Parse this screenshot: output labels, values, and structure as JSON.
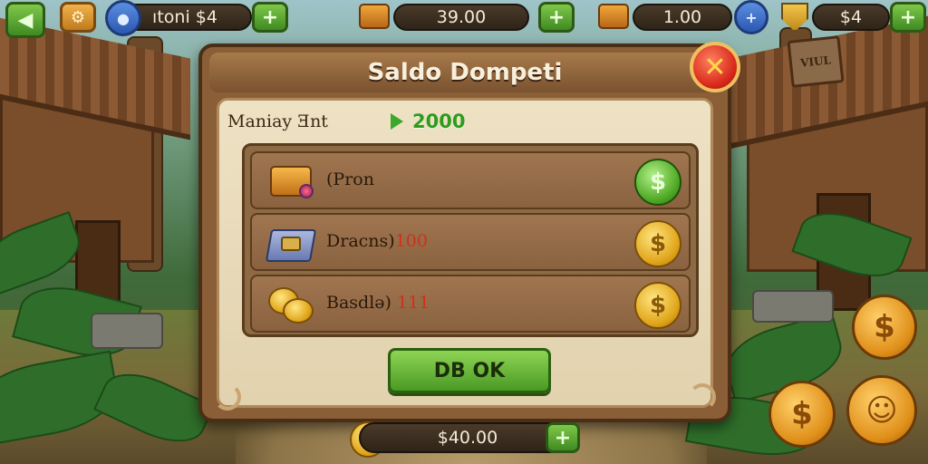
{
  "hud": {
    "back_icon": "arrow-left-icon",
    "resource_1_label": "ıtoni $4",
    "resource_2_value": "39.00",
    "resource_3_value": "1.00",
    "resource_4_value": "$4",
    "plus_symbol": "+"
  },
  "dialog": {
    "title": "Saldo Dompeti",
    "close_symbol": "✕",
    "summary": {
      "label": "Maniay Ǝnt",
      "value": "2000"
    },
    "items": [
      {
        "name": "(Pron",
        "qty": "",
        "icon": "treasure-chest-icon",
        "coin": "green-coin"
      },
      {
        "name": "Dracns)",
        "qty": "100",
        "icon": "crate-icon",
        "coin": "gold-coin"
      },
      {
        "name": "Basdlə)",
        "qty": "111",
        "icon": "coins-icon",
        "coin": "gold-coin"
      }
    ],
    "ok_label": "DB OK"
  },
  "bottom_hud": {
    "value": "$40.00"
  },
  "scene": {
    "hut_sign": "VIUL"
  },
  "colors": {
    "accent_green": "#4a9a24",
    "accent_gold": "#e0a41a",
    "close_red": "#d8281a",
    "dialog_wood": "#8a5e36"
  }
}
